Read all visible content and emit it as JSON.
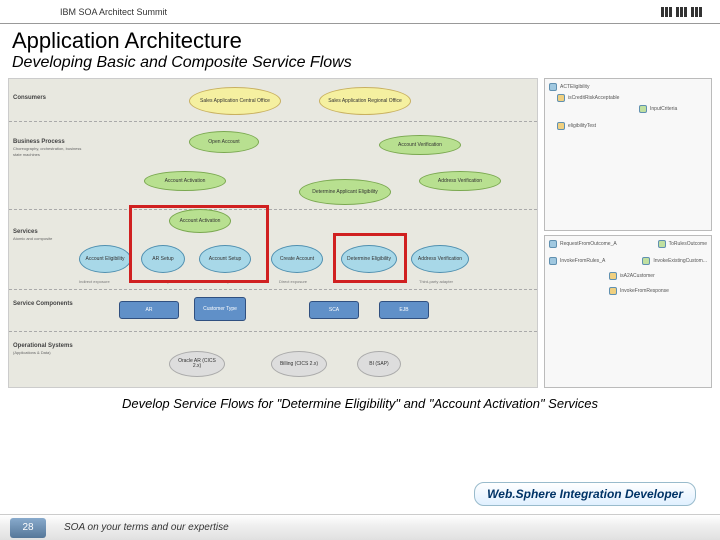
{
  "header": {
    "event": "IBM SOA Architect Summit",
    "logo_alt": "IBM"
  },
  "title": "Application Architecture",
  "subtitle": "Developing Basic and Composite Service Flows",
  "diagram": {
    "rows": {
      "consumers": "Consumers",
      "process": "Business Process",
      "process_sub": "Choreography, orchestration, business state machines",
      "services": "Services",
      "services_sub": "Atomic and composite",
      "components": "Service Components",
      "ops": "Operational Systems",
      "ops_sub": "(Applications & Data)"
    },
    "consumers": {
      "central": "Sales Application Central Office",
      "regional": "Sales Application Regional Office"
    },
    "process": {
      "open": "Open Account",
      "acctver": "Account Verification",
      "acctact": "Account Activation",
      "deteli": "Determine Applicant Eligibility",
      "addrver": "Address Verification"
    },
    "services": {
      "acctact": "Account Activation",
      "aceli": "Account Eligibility",
      "arsetup": "AR Setup",
      "acsetup": "Account Setup",
      "create": "Create Account",
      "deteli": "Determine Eligibility",
      "addrver": "Address Verification"
    },
    "svc_notes": {
      "n1": "Indirect exposure",
      "n2": "Indirect exposure",
      "n3": "Indirect exposure",
      "n4": "Direct exposure",
      "n5": "Third-party adapter"
    },
    "components": {
      "ar": "AR",
      "cust": "Customer Type",
      "sca": "SCA",
      "ejb": "EJB"
    },
    "ops": {
      "oracle": "Oracle AR (CICS 2.x)",
      "billing": "Billing (CICS 2.x)",
      "bi": "BI (SAP)"
    }
  },
  "sidepanel": {
    "top": {
      "a": "ACTEligibility",
      "b": "isCreditRiskAcceptable",
      "c": "eligibilityTest",
      "d": "InputCriteria"
    },
    "bottom": {
      "a": "RequestFromOutcome_A",
      "b": "ToRulesOutcome",
      "c": "InvokeFromRules_A",
      "d": "InvokeExistingCustom...",
      "e": "isA2ACustomer",
      "f": "InvokeFromResponse"
    }
  },
  "caption": "Develop Service Flows for \"Determine Eligibility\" and \"Account Activation\" Services",
  "tool_badge": "Web.Sphere Integration Developer",
  "footer": {
    "page": "28",
    "tagline": "SOA on your terms and our expertise"
  }
}
